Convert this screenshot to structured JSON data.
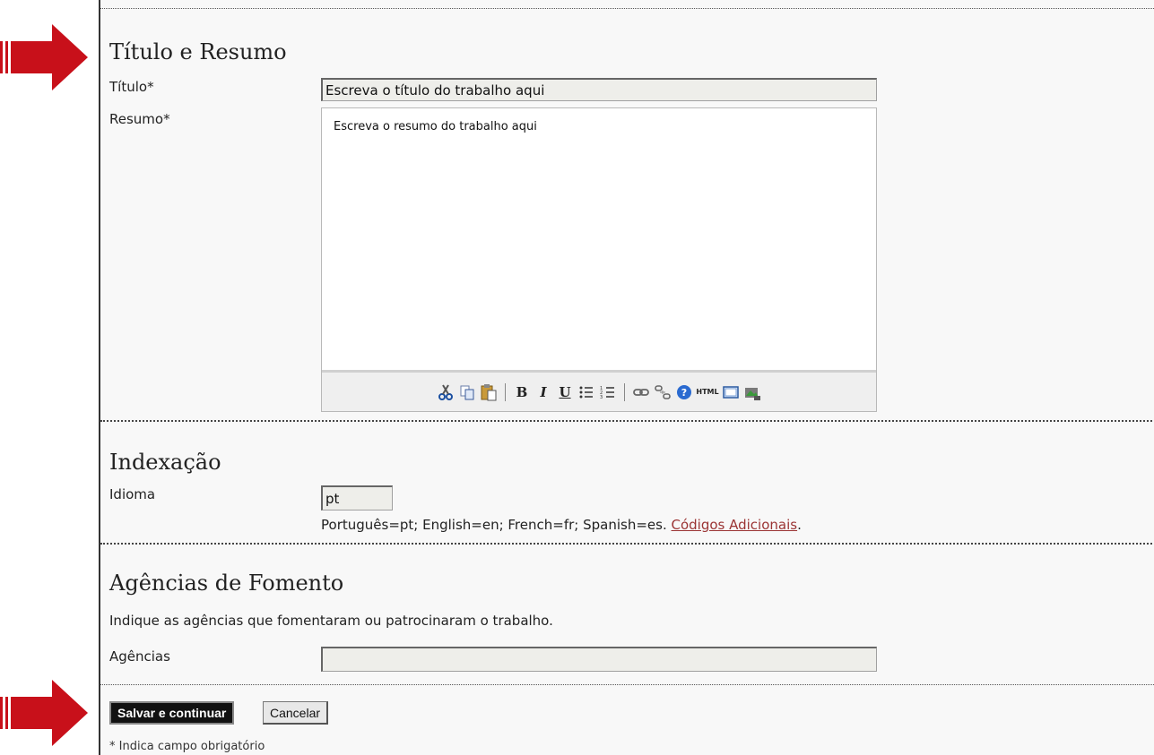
{
  "sections": {
    "title_abstract": {
      "heading": "Título e Resumo",
      "title_label": "Título*",
      "title_value": "Escreva o título do trabalho aqui",
      "abstract_label": "Resumo*",
      "abstract_value": "Escreva o resumo do trabalho aqui"
    },
    "indexing": {
      "heading": "Indexação",
      "language_label": "Idioma",
      "language_value": "pt",
      "language_hint": "Português=pt; English=en; French=fr; Spanish=es.",
      "additional_codes_link": "Códigos Adicionais",
      "hint_suffix": "."
    },
    "funding": {
      "heading": "Agências de Fomento",
      "description": "Indique as agências que fomentaram ou patrocinaram o trabalho.",
      "agencies_label": "Agências",
      "agencies_value": ""
    }
  },
  "editor_toolbar": {
    "bold": "B",
    "italic": "I",
    "underline": "U",
    "html": "HTML"
  },
  "actions": {
    "save_label": "Salvar e continuar",
    "cancel_label": "Cancelar"
  },
  "footnote": "* Indica campo obrigatório",
  "colors": {
    "arrow": "#c8101a",
    "link": "#9b3434",
    "primary_button": "#111111"
  }
}
